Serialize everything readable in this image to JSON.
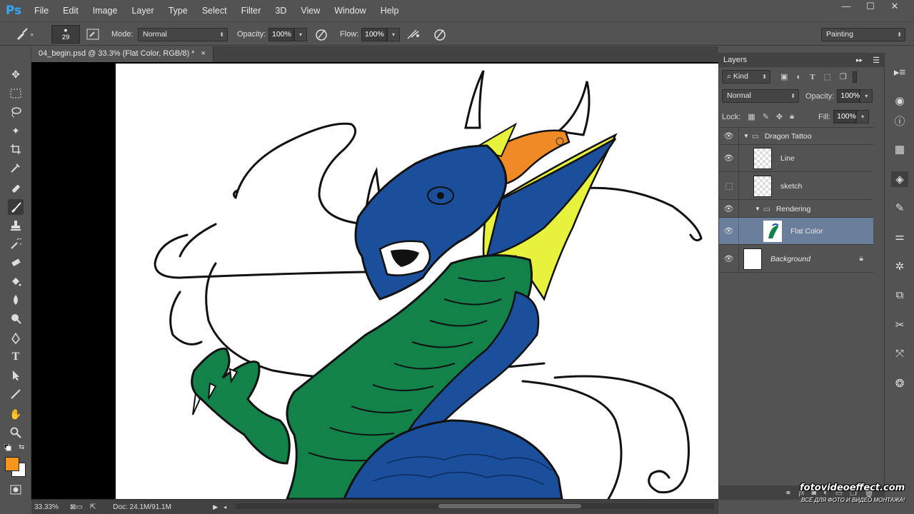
{
  "app": {
    "logo": "Ps"
  },
  "menu": [
    "File",
    "Edit",
    "Image",
    "Layer",
    "Type",
    "Select",
    "Filter",
    "3D",
    "View",
    "Window",
    "Help"
  ],
  "window_controls": [
    "—",
    "☐",
    "✕"
  ],
  "options": {
    "brush_size": "29",
    "mode_label": "Mode:",
    "mode_value": "Normal",
    "opacity_label": "Opacity:",
    "opacity_value": "100%",
    "flow_label": "Flow:",
    "flow_value": "100%",
    "workspace": "Painting"
  },
  "document": {
    "tab_title": "04_begin.psd @ 33.3% (Flat Color, RGB/8) *",
    "close": "×"
  },
  "status": {
    "zoom": "33.33%",
    "doc_info": "Doc: 24.1M/91.1M"
  },
  "colors": {
    "foreground": "#f7941d",
    "background": "#ffffff",
    "dragon_blue": "#1b4f9c",
    "dragon_green": "#12824a",
    "wing_yellow": "#e6f23c",
    "horn_orange": "#f08a24",
    "selected_layer": "#6b7f9c"
  },
  "layers_panel": {
    "title": "Layers",
    "filter_kind": "Kind",
    "blend_mode": "Normal",
    "opacity_label": "Opacity:",
    "opacity_value": "100%",
    "lock_label": "Lock:",
    "fill_label": "Fill:",
    "fill_value": "100%",
    "layers": [
      {
        "name": "Dragon Tattoo",
        "type": "group",
        "visible": true
      },
      {
        "name": "Line",
        "type": "layer",
        "visible": true
      },
      {
        "name": "sketch",
        "type": "layer",
        "visible": false
      },
      {
        "name": "Rendering",
        "type": "group",
        "visible": true
      },
      {
        "name": "Flat Color",
        "type": "layer",
        "visible": true,
        "selected": true
      },
      {
        "name": "Background",
        "type": "background",
        "visible": true,
        "locked": true
      }
    ],
    "footer_icons": [
      "link-icon",
      "fx-icon",
      "mask-icon",
      "adjustment-icon",
      "folder-icon",
      "new-layer-icon",
      "trash-icon"
    ]
  },
  "tools": [
    "move-tool",
    "marquee-tool",
    "lasso-tool",
    "magic-wand-tool",
    "crop-tool",
    "eyedropper-tool",
    "healing-tool",
    "brush-tool",
    "stamp-tool",
    "history-brush-tool",
    "eraser-tool",
    "bucket-tool",
    "blur-tool",
    "dodge-tool",
    "pen-tool",
    "type-tool",
    "path-select-tool",
    "line-tool",
    "hand-tool",
    "zoom-tool"
  ],
  "watermark": {
    "main": "fotovideoeffect.com",
    "sub": "ВСЁ ДЛЯ ФОТО И ВИДЕО МОНТАЖА!"
  }
}
